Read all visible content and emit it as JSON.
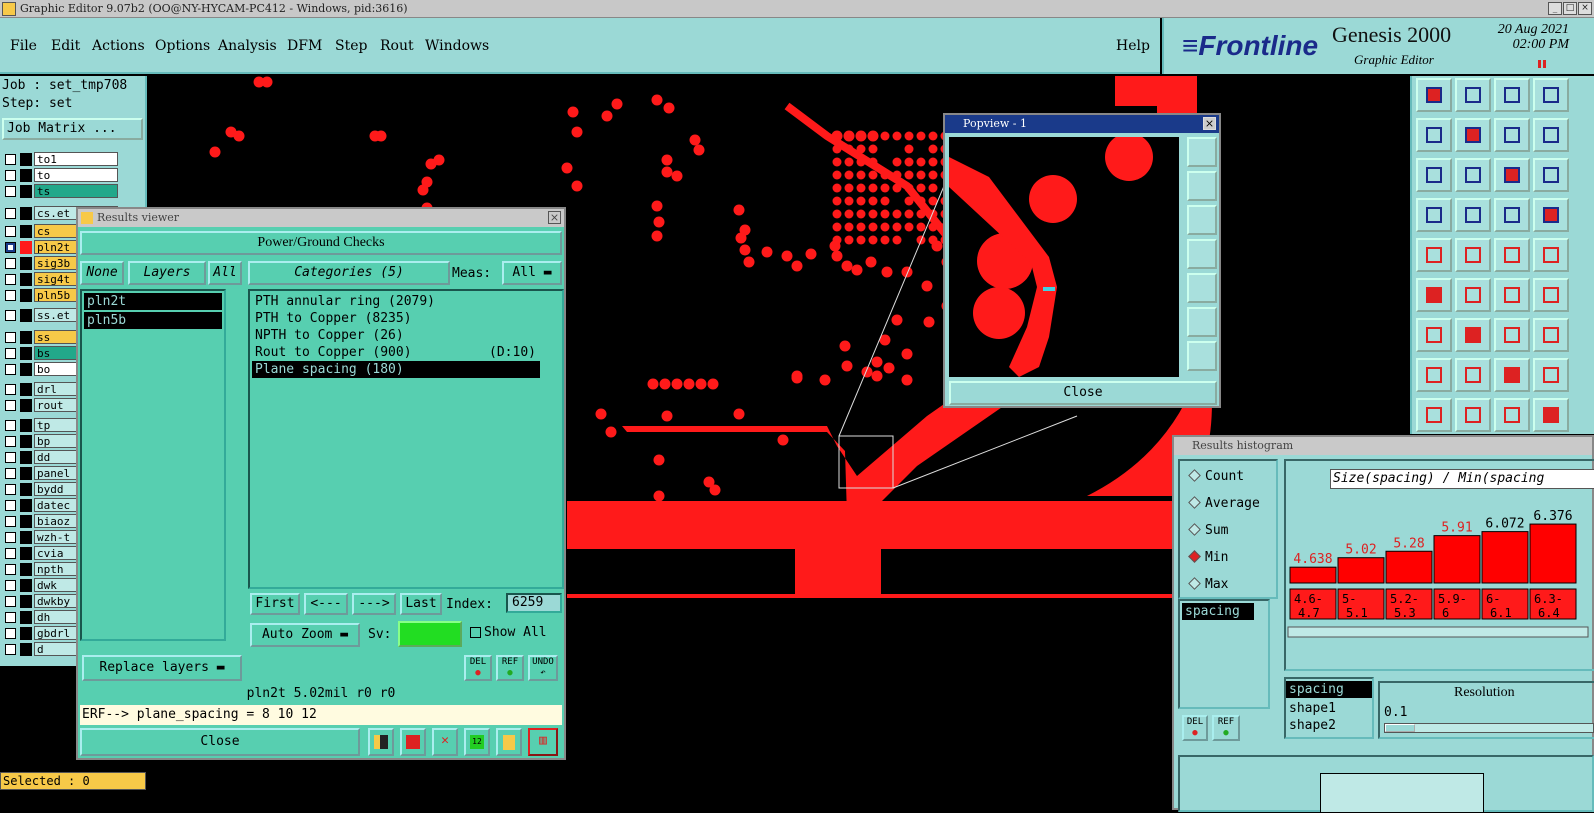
{
  "window": {
    "title": "Graphic Editor 9.07b2 (OO@NY-HYCAM-PC412 - Windows, pid:3616)"
  },
  "menu": [
    "File",
    "Edit",
    "Actions",
    "Options",
    "Analysis",
    "DFM",
    "Step",
    "Rout",
    "Windows"
  ],
  "help": "Help",
  "brand": {
    "logo": "Frontline",
    "product": "Genesis 2000",
    "subtitle": "Graphic Editor",
    "date": "20 Aug 2021",
    "time": "02:00 PM"
  },
  "job": {
    "job": "Job : set_tmp708",
    "step": "Step: set",
    "matrix_button": "Job Matrix ..."
  },
  "layers": [
    {
      "name": "to1",
      "color": "#ffffff"
    },
    {
      "name": "to",
      "color": "#ffffff"
    },
    {
      "name": "ts",
      "color": "#22a88a"
    },
    {
      "name": "cs.et",
      "color": "#bfe9e6"
    },
    {
      "name": "cs",
      "color": "#f7c948"
    },
    {
      "name": "pln2t",
      "color": "#f7c948",
      "active": true
    },
    {
      "name": "sig3b",
      "color": "#f7c948"
    },
    {
      "name": "sig4t",
      "color": "#f7c948"
    },
    {
      "name": "pln5b",
      "color": "#f7c948"
    },
    {
      "name": "ss.et",
      "color": "#bfe9e6"
    },
    {
      "name": "ss",
      "color": "#f7c948"
    },
    {
      "name": "bs",
      "color": "#22a88a"
    },
    {
      "name": "bo",
      "color": "#ffffff"
    },
    {
      "name": "drl",
      "color": "#bfe9e6"
    },
    {
      "name": "rout",
      "color": "#bfe9e6"
    },
    {
      "name": "tp",
      "color": "#bfe9e6"
    },
    {
      "name": "bp",
      "color": "#bfe9e6"
    },
    {
      "name": "dd",
      "color": "#bfe9e6"
    },
    {
      "name": "panel",
      "color": "#bfe9e6"
    },
    {
      "name": "bydd",
      "color": "#bfe9e6"
    },
    {
      "name": "datec",
      "color": "#bfe9e6"
    },
    {
      "name": "biaoz",
      "color": "#bfe9e6"
    },
    {
      "name": "wzh-t",
      "color": "#bfe9e6"
    },
    {
      "name": "cvia",
      "color": "#bfe9e6"
    },
    {
      "name": "npth",
      "color": "#bfe9e6"
    },
    {
      "name": "dwk",
      "color": "#bfe9e6"
    },
    {
      "name": "dwkby",
      "color": "#bfe9e6"
    },
    {
      "name": "dh",
      "color": "#bfe9e6"
    },
    {
      "name": "gbdrl",
      "color": "#bfe9e6"
    },
    {
      "name": "d",
      "color": "#bfe9e6"
    }
  ],
  "selected": "Selected : 0",
  "results_viewer": {
    "title": "Results viewer",
    "header": "Power/Ground Checks",
    "none_btn": "None",
    "layers_btn": "Layers",
    "all_btn": "All",
    "categories_btn": "Categories (5)",
    "meas_label": "Meas:",
    "meas_value": "All",
    "layer_items": [
      "pln2t",
      "pln5b"
    ],
    "categories": [
      {
        "label": "PTH annular ring (2079)",
        "extra": ""
      },
      {
        "label": "PTH to Copper (8235)",
        "extra": ""
      },
      {
        "label": "NPTH to Copper (26)",
        "extra": ""
      },
      {
        "label": "Rout to Copper (900)",
        "extra": "(D:10)"
      },
      {
        "label": "Plane spacing (180)",
        "extra": "",
        "selected": true
      }
    ],
    "first": "First",
    "prev": "<---",
    "next": "--->",
    "last": "Last",
    "index_label": "Index:",
    "index_value": "6259",
    "auto_zoom": "Auto Zoom",
    "sv_label": "Sv:",
    "show_all": "Show All",
    "replace_layers": "Replace layers",
    "status": "pln2t 5.02mil  r0  r0",
    "erf": "ERF--> plane_spacing = 8 10 12",
    "close": "Close",
    "del": "DEL",
    "ref": "REF",
    "undo": "UNDO"
  },
  "popview": {
    "title": "Popview - 1",
    "close": "Close"
  },
  "histogram": {
    "title": "Results histogram",
    "modes": [
      "Count",
      "Average",
      "Sum",
      "Min",
      "Max"
    ],
    "selected_mode": "Min",
    "chart_title": "Size(spacing) / Min(spacing",
    "list": [
      "spacing"
    ],
    "attrs": [
      "spacing",
      "shape1",
      "shape2"
    ],
    "resolution_label": "Resolution",
    "resolution_value": "0.1",
    "del": "DEL",
    "ref": "REF"
  },
  "chart_data": {
    "type": "bar",
    "title": "Size(spacing) / Min(spacing",
    "categories": [
      "4.6-4.7",
      "5-5.1",
      "5.2-5.3",
      "5.9-6",
      "6-6.1",
      "6.3-6.4"
    ],
    "values": [
      4.638,
      5.02,
      5.28,
      5.91,
      6.072,
      6.376
    ],
    "value_labels": [
      "4.638",
      "5.02",
      "5.28",
      "5.91",
      "6.072",
      "6.376"
    ],
    "bar_color": "#ff0000"
  }
}
